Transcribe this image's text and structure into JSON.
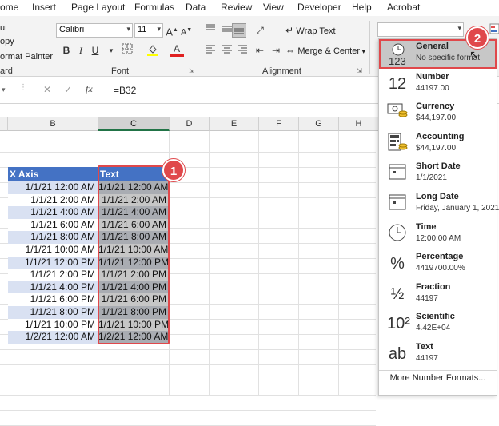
{
  "menu": [
    "ome",
    "Insert",
    "Page Layout",
    "Formulas",
    "Data",
    "Review",
    "View",
    "Developer",
    "Help",
    "Acrobat"
  ],
  "clipboard": {
    "cut": "ut",
    "copy": "opy",
    "format_painter": "ormat Painter",
    "group": "ard"
  },
  "font": {
    "name": "Calibri",
    "size": "11",
    "group": "Font",
    "bold": "B",
    "italic": "I",
    "underline": "U"
  },
  "alignment": {
    "wrap_text": "Wrap Text",
    "merge_center": "Merge & Center",
    "group": "Alignment"
  },
  "number_format_box": {
    "value": ""
  },
  "formula_bar": {
    "cancel": "✕",
    "enter": "✓",
    "fx": "fx",
    "formula": "=B32"
  },
  "columns": [
    "B",
    "C",
    "D",
    "E",
    "F",
    "G",
    "H"
  ],
  "table": {
    "header_b": "X Axis",
    "header_c": "Text",
    "col_b": [
      "1/1/21 12:00 AM",
      "1/1/21 2:00 AM",
      "1/1/21 4:00 AM",
      "1/1/21 6:00 AM",
      "1/1/21 8:00 AM",
      "1/1/21 10:00 AM",
      "1/1/21 12:00 PM",
      "1/1/21 2:00 PM",
      "1/1/21 4:00 PM",
      "1/1/21 6:00 PM",
      "1/1/21 8:00 PM",
      "1/1/21 10:00 PM",
      "1/2/21 12:00 AM"
    ],
    "col_c": [
      "1/1/21 12:00 AM",
      "1/1/21 2:00 AM",
      "1/1/21 4:00 AM",
      "1/1/21 6:00 AM",
      "1/1/21 8:00 AM",
      "1/1/21 10:00 AM",
      "1/1/21 12:00 PM",
      "1/1/21 2:00 PM",
      "1/1/21 4:00 PM",
      "1/1/21 6:00 PM",
      "1/1/21 8:00 PM",
      "1/1/21 10:00 PM",
      "1/2/21 12:00 AM"
    ]
  },
  "badges": {
    "one": "1",
    "two": "2"
  },
  "formats": [
    {
      "name": "General",
      "example": "No specific format",
      "icon": "123"
    },
    {
      "name": "Number",
      "example": "44197.00",
      "icon": "12"
    },
    {
      "name": "Currency",
      "example": "$44,197.00",
      "icon": "currency-icon"
    },
    {
      "name": "Accounting",
      "example": "$44,197.00",
      "icon": "calculator-icon"
    },
    {
      "name": "Short Date",
      "example": "1/1/2021",
      "icon": "calendar-icon"
    },
    {
      "name": "Long Date",
      "example": "Friday, January 1, 2021",
      "icon": "calendar-icon"
    },
    {
      "name": "Time",
      "example": "12:00:00 AM",
      "icon": "clock-icon"
    },
    {
      "name": "Percentage",
      "example": "4419700.00%",
      "icon": "%"
    },
    {
      "name": "Fraction",
      "example": "44197",
      "icon": "½"
    },
    {
      "name": "Scientific",
      "example": "4.42E+04",
      "icon": "10²"
    },
    {
      "name": "Text",
      "example": "44197",
      "icon": "ab"
    }
  ],
  "more_formats": "More Number Formats..."
}
